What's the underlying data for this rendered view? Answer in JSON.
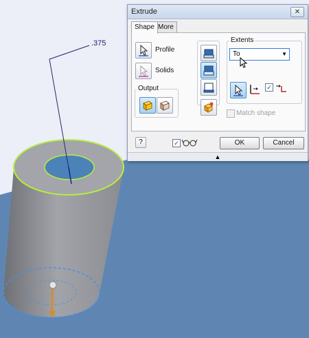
{
  "viewport": {
    "dimension_label": ".375",
    "colors": {
      "background": "#eceef8",
      "ground": "#5f86b3",
      "cylinder": "#9c9ea3",
      "selection": "#b7ef3a",
      "profile_edge": "#4a90e2"
    }
  },
  "dialog": {
    "title": "Extrude",
    "close_glyph": "✕",
    "tabs": [
      {
        "label": "Shape"
      },
      {
        "label": "More"
      }
    ],
    "profile_label": "Profile",
    "solids_label": "Solids",
    "output_label": "Output",
    "extents_label": "Extents",
    "extents_value": "To",
    "match_shape_label": "Match shape",
    "ok_label": "OK",
    "cancel_label": "Cancel",
    "help_glyph": "?",
    "preview_checked": true,
    "check_glyph": "✓",
    "expand_glyph": "▲",
    "combo_arrow": "▼"
  }
}
